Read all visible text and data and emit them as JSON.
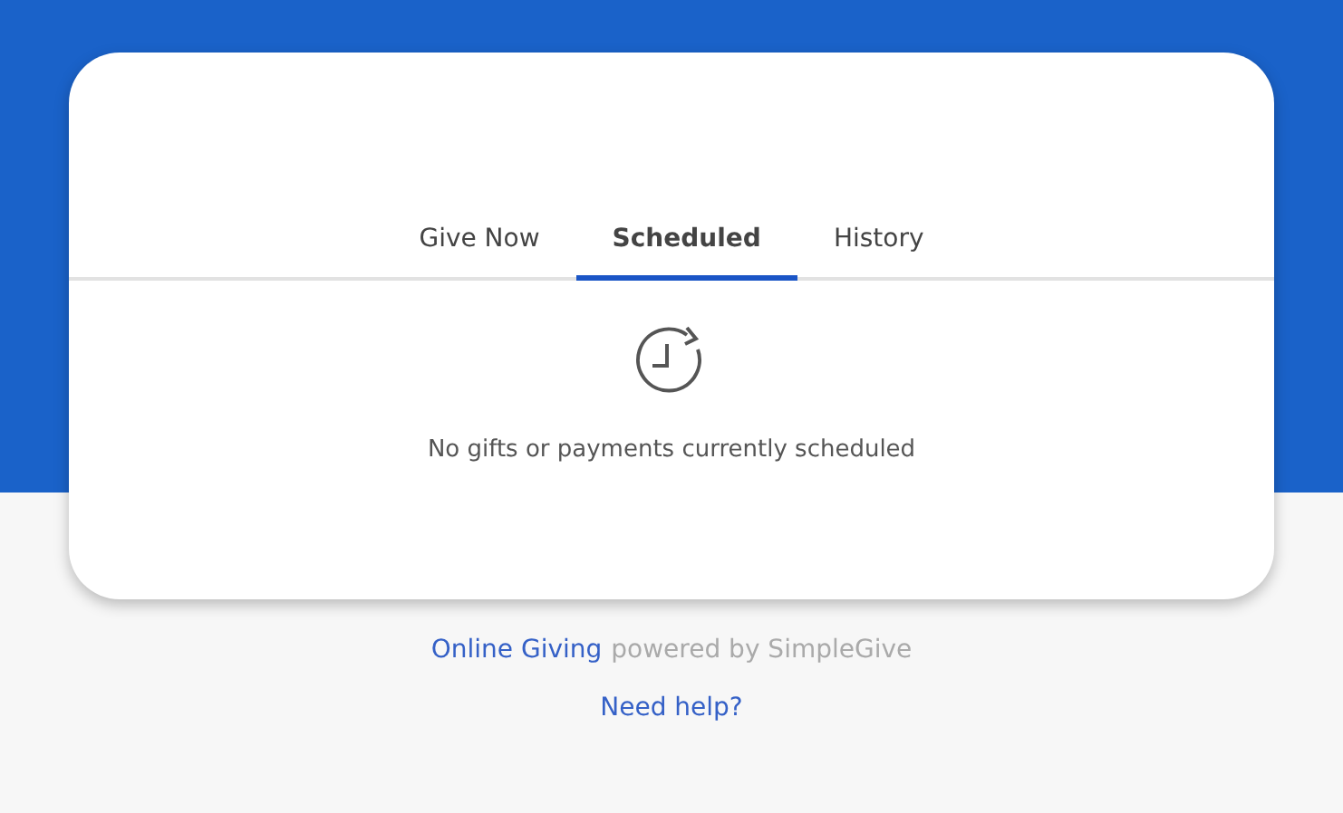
{
  "tabs": [
    {
      "label": "Give Now",
      "selected": false
    },
    {
      "label": "Scheduled",
      "selected": true
    },
    {
      "label": "History",
      "selected": false
    }
  ],
  "empty_state": {
    "message": "No gifts or payments currently scheduled"
  },
  "footer": {
    "link": "Online Giving",
    "credit": "powered by SimpleGive",
    "help": "Need help?"
  }
}
